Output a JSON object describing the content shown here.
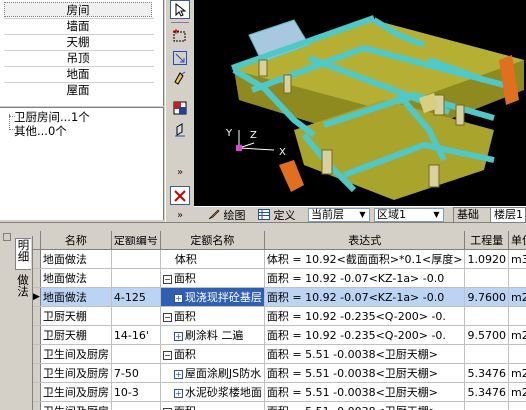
{
  "categories": {
    "selected_index": 0,
    "items": [
      "房间",
      "墙面",
      "天棚",
      "吊顶",
      "地面",
      "屋面"
    ]
  },
  "summary": {
    "items": [
      "卫厨房间...1个",
      "其他...0个"
    ]
  },
  "view_toolbar": {
    "drawing_label": "绘图",
    "define_label": "定义",
    "floor_select_value": "当前层",
    "region_select_value": "区域1",
    "tabs": [
      "基础",
      "楼层1"
    ]
  },
  "side_tabs": {
    "detail_label": "明细",
    "method_label": "做法"
  },
  "axes": {
    "x": "X",
    "y": "Y",
    "z": "Z"
  },
  "table": {
    "headers": {
      "name": "名称",
      "code": "定额编号",
      "quota_name": "定额名称",
      "expression": "表达式",
      "quantity": "工程量",
      "unit": "单位"
    },
    "selected_row": 2,
    "rows": [
      {
        "name": "地面做法",
        "code": "",
        "quota_name": "体积",
        "quota_type": "none",
        "expression": "体积 = 10.92<截面面积>*0.1<厚度>",
        "quantity": "1.0920",
        "unit": "m3"
      },
      {
        "name": "地面做法",
        "code": "",
        "quota_name": "面积",
        "quota_type": "minus",
        "expression": "面积 = 10.92 -0.07<KZ-1a> -0.0",
        "quantity": "",
        "unit": ""
      },
      {
        "name": "地面做法",
        "code": "4-125",
        "quota_name": "现浇现拌砼基层",
        "quota_type": "plus",
        "expression": "面积 = 10.92 -0.07<KZ-1a> -0.0",
        "quantity": "9.7600",
        "unit": "m2"
      },
      {
        "name": "卫厨天棚",
        "code": "",
        "quota_name": "面积",
        "quota_type": "minus",
        "expression": "面积 = 10.92 -0.235<Q-200> -0.",
        "quantity": "",
        "unit": ""
      },
      {
        "name": "卫厨天棚",
        "code": "14-16'",
        "quota_name": "刷涂料 二遍",
        "quota_type": "plus",
        "expression": "面积 = 10.92 -0.235<Q-200> -0.",
        "quantity": "9.5700",
        "unit": "m2"
      },
      {
        "name": "卫生间及厨房",
        "code": "",
        "quota_name": "面积",
        "quota_type": "minus",
        "expression": "面积 = 5.51 -0.0038<卫厨天棚>",
        "quantity": "",
        "unit": ""
      },
      {
        "name": "卫生间及厨房",
        "code": "7-50",
        "quota_name": "屋面涂刷JS防水",
        "quota_type": "plus",
        "expression": "面积 = 5.51 -0.0038<卫厨天棚>",
        "quantity": "5.3476",
        "unit": "m2"
      },
      {
        "name": "卫生间及厨房",
        "code": "10-3",
        "quota_name": "水泥砂浆楼地面",
        "quota_type": "plus",
        "expression": "面积 = 5.51 -0.0038<卫厨天棚>",
        "quantity": "5.3476",
        "unit": "m2"
      },
      {
        "name": "卫生间及厨房",
        "code": "",
        "quota_name": "面积",
        "quota_type": "minus",
        "expression": "面积 = 5.51 -0.0038<卫厨天棚>",
        "quantity": "",
        "unit": ""
      }
    ]
  },
  "colors": {
    "panel_bg": "#d4d0c8",
    "view_bg": "#000000",
    "wall_olive": "#b5b033",
    "beam_cyan": "#4fc8c8",
    "accent_orange": "#e07020",
    "selected_row_bg": "#bcd4f4"
  }
}
